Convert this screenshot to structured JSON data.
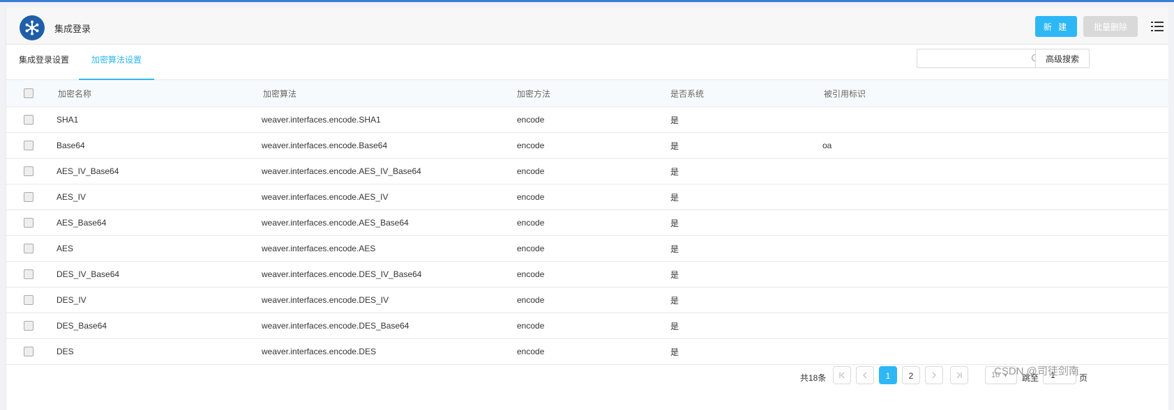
{
  "app": {
    "title": "集成登录"
  },
  "toolbar": {
    "new_label": "新 建",
    "batch_delete_label": "批量删除"
  },
  "tabs": [
    {
      "label": "集成登录设置"
    },
    {
      "label": "加密算法设置"
    }
  ],
  "search": {
    "placeholder": "",
    "advanced_label": "高级搜索"
  },
  "table": {
    "columns": [
      "加密名称",
      "加密算法",
      "加密方法",
      "是否系统",
      "被引用标识"
    ],
    "rows": [
      {
        "name": "SHA1",
        "algo": "weaver.interfaces.encode.SHA1",
        "method": "encode",
        "system": "是",
        "ref": ""
      },
      {
        "name": "Base64",
        "algo": "weaver.interfaces.encode.Base64",
        "method": "encode",
        "system": "是",
        "ref": "oa"
      },
      {
        "name": "AES_IV_Base64",
        "algo": "weaver.interfaces.encode.AES_IV_Base64",
        "method": "encode",
        "system": "是",
        "ref": ""
      },
      {
        "name": "AES_IV",
        "algo": "weaver.interfaces.encode.AES_IV",
        "method": "encode",
        "system": "是",
        "ref": ""
      },
      {
        "name": "AES_Base64",
        "algo": "weaver.interfaces.encode.AES_Base64",
        "method": "encode",
        "system": "是",
        "ref": ""
      },
      {
        "name": "AES",
        "algo": "weaver.interfaces.encode.AES",
        "method": "encode",
        "system": "是",
        "ref": ""
      },
      {
        "name": "DES_IV_Base64",
        "algo": "weaver.interfaces.encode.DES_IV_Base64",
        "method": "encode",
        "system": "是",
        "ref": ""
      },
      {
        "name": "DES_IV",
        "algo": "weaver.interfaces.encode.DES_IV",
        "method": "encode",
        "system": "是",
        "ref": ""
      },
      {
        "name": "DES_Base64",
        "algo": "weaver.interfaces.encode.DES_Base64",
        "method": "encode",
        "system": "是",
        "ref": ""
      },
      {
        "name": "DES",
        "algo": "weaver.interfaces.encode.DES",
        "method": "encode",
        "system": "是",
        "ref": ""
      }
    ]
  },
  "pagination": {
    "total_label": "共18条",
    "pages": [
      "1",
      "2"
    ],
    "current_page": "1",
    "page_size": "10",
    "jump_label": "跳至",
    "jump_value": "1",
    "page_suffix": "页"
  },
  "watermark": "CSDN @司徒剑南",
  "colors": {
    "accent": "#2db7f5",
    "logo": "#1f5fa8",
    "topline": "#3a7bd5"
  },
  "icons": {
    "logo": "snowflake-logo-icon",
    "menu": "list-menu-icon",
    "search": "search-icon"
  }
}
